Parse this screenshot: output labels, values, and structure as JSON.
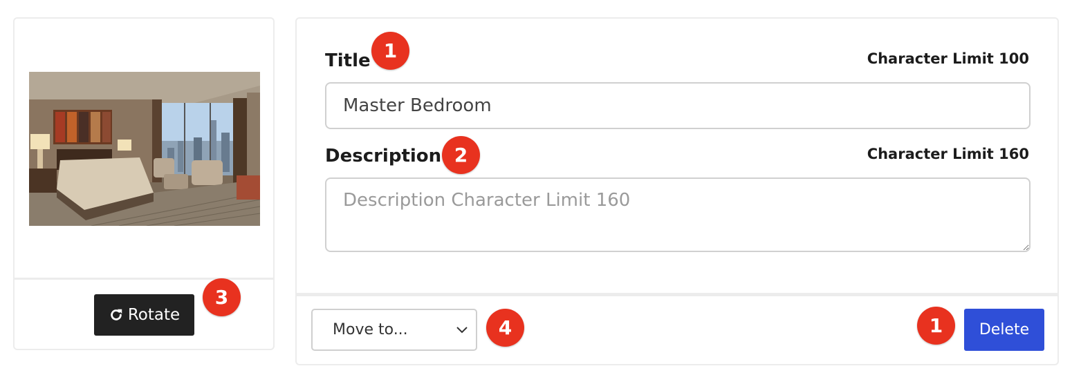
{
  "photo": {
    "alt": "Master bedroom photo"
  },
  "rotate_button": {
    "label": "Rotate",
    "icon": "rotate-icon"
  },
  "title_field": {
    "label": "Title",
    "limit_text": "Character Limit 100",
    "value": "Master Bedroom"
  },
  "description_field": {
    "label": "Description",
    "limit_text": "Character Limit 160",
    "placeholder": "Description Character Limit 160",
    "value": ""
  },
  "move_select": {
    "selected": "Move to...",
    "icon": "chevron-down-icon"
  },
  "delete_button": {
    "label": "Delete"
  },
  "badges": {
    "title": "1",
    "description": "2",
    "rotate": "3",
    "move": "4",
    "delete": "1"
  },
  "colors": {
    "badge": "#e8321f",
    "delete_button": "#2f4fd8",
    "rotate_button": "#222222"
  }
}
